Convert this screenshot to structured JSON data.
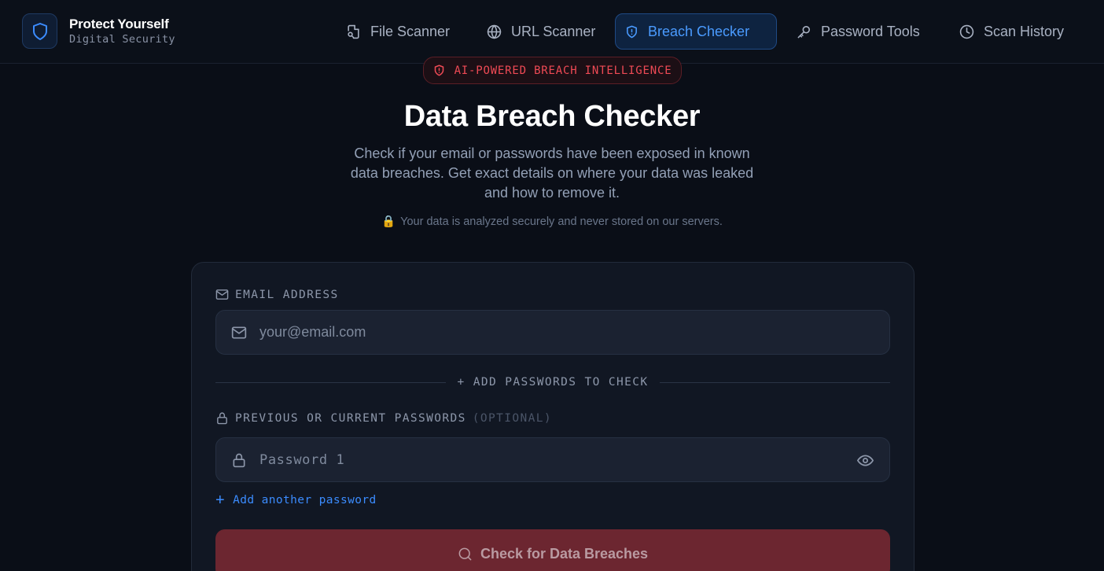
{
  "brand": {
    "title": "Protect Yourself",
    "subtitle": "Digital Security"
  },
  "nav": {
    "items": [
      {
        "label": "File Scanner",
        "icon": "file-search-icon",
        "active": false
      },
      {
        "label": "URL Scanner",
        "icon": "globe-icon",
        "active": false
      },
      {
        "label": "Breach Checker",
        "icon": "shield-alert-icon",
        "active": true
      },
      {
        "label": "Password Tools",
        "icon": "key-icon",
        "active": false
      },
      {
        "label": "Scan History",
        "icon": "clock-icon",
        "active": false
      }
    ]
  },
  "hero": {
    "badge": "AI-POWERED BREACH INTELLIGENCE",
    "title": "Data Breach Checker",
    "subtitle": "Check if your email or passwords have been exposed in known data breaches. Get exact details on where your data was leaked and how to remove it.",
    "note": "Your data is analyzed securely and never stored on our servers.",
    "note_icon": "🔒"
  },
  "form": {
    "email_label": "EMAIL ADDRESS",
    "email_placeholder": "your@email.com",
    "email_value": "",
    "divider_text": "+ ADD PASSWORDS TO CHECK",
    "password_label": "PREVIOUS OR CURRENT PASSWORDS",
    "password_optional": "(OPTIONAL)",
    "password_placeholder": "Password 1",
    "password_value": "",
    "add_password": "Add another password",
    "add_password_icon": "+",
    "submit_label": "Check for Data Breaches"
  },
  "colors": {
    "background": "#0a0e17",
    "accent_blue": "#3b8cff",
    "accent_red": "#ef4a55",
    "button_red": "#6c2630"
  }
}
